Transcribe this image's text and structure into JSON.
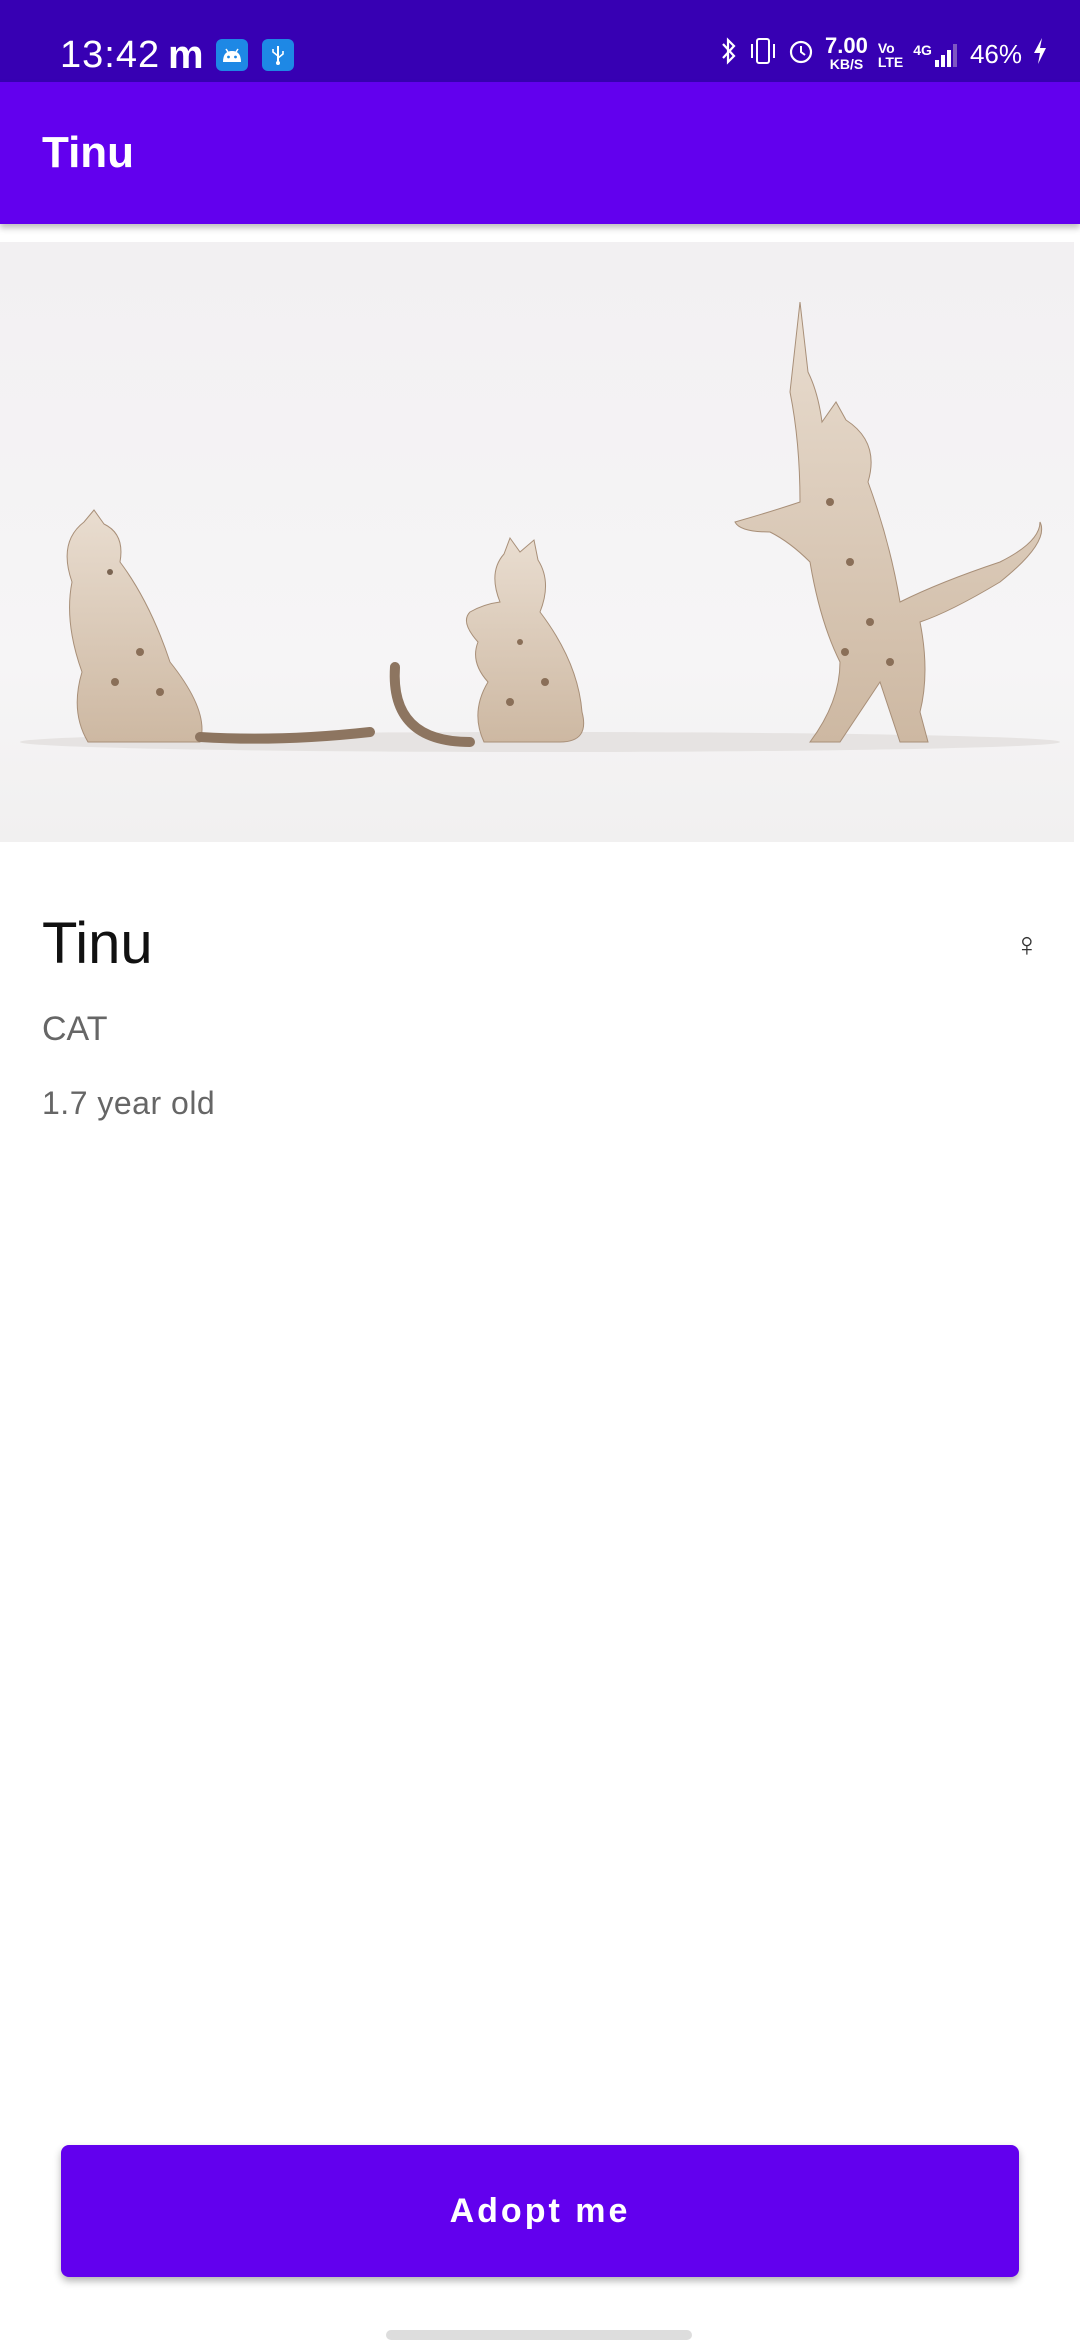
{
  "status_bar": {
    "time": "13:42",
    "net_speed_value": "7.00",
    "net_speed_unit": "KB/S",
    "volte_top": "Vo",
    "volte_bottom": "LTE",
    "network": "4G",
    "battery": "46%",
    "icons": [
      "m-notification-icon",
      "android-icon",
      "usb-icon",
      "bluetooth-icon",
      "vibrate-icon",
      "alarm-icon",
      "signal-icon",
      "charging-icon"
    ]
  },
  "app_bar": {
    "title": "Tinu"
  },
  "hero_image": {
    "subject": "three spotted cats"
  },
  "pet": {
    "name": "Tinu",
    "gender_symbol": "♀",
    "type": "CAT",
    "age": "1.7 year old"
  },
  "actions": {
    "adopt_label": "Adopt me"
  },
  "colors": {
    "status_bar": "#3700b3",
    "primary": "#6200ee"
  }
}
